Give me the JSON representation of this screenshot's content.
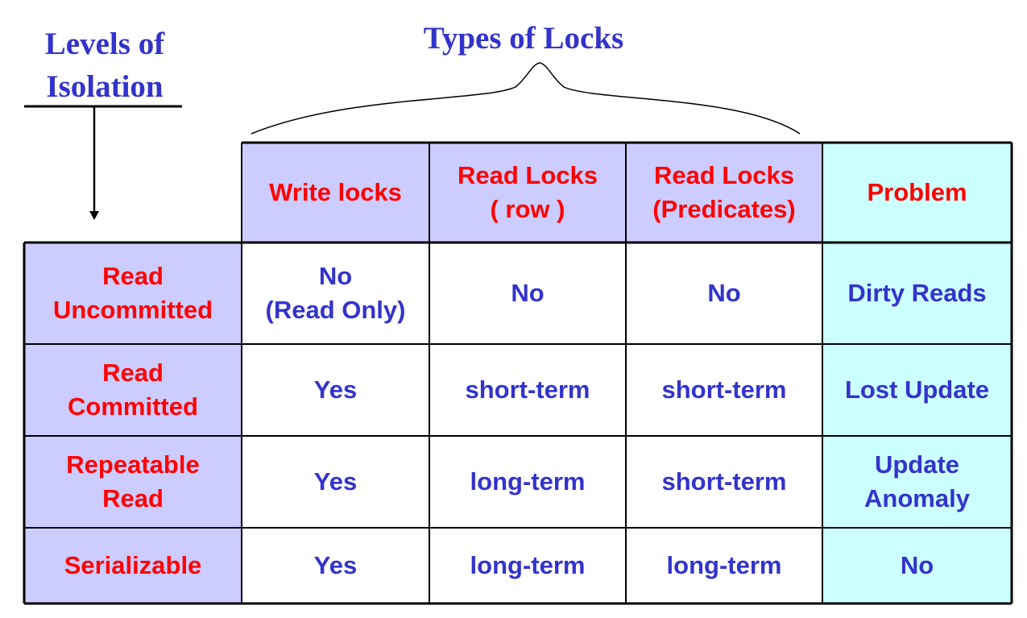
{
  "titles": {
    "levels_line1": "Levels of",
    "levels_line2": "Isolation",
    "types": "Types of Locks"
  },
  "columns": [
    "Write locks",
    "Read Locks\n( row )",
    "Read Locks\n(Predicates)",
    "Problem"
  ],
  "rows": [
    {
      "level": "Read\nUncommitted",
      "write": "No\n(Read Only)",
      "read_row": "No",
      "read_pred": "No",
      "problem": "Dirty Reads"
    },
    {
      "level": "Read\nCommitted",
      "write": "Yes",
      "read_row": "short-term",
      "read_pred": "short-term",
      "problem": "Lost Update"
    },
    {
      "level": "Repeatable\nRead",
      "write": "Yes",
      "read_row": "long-term",
      "read_pred": "short-term",
      "problem": "Update\nAnomaly"
    },
    {
      "level": "Serializable",
      "write": "Yes",
      "read_row": "long-term",
      "read_pred": "long-term",
      "problem": "No"
    }
  ],
  "colors": {
    "title_blue": "#3333CC",
    "header_red": "#FF0000",
    "lavender": "#CCCCFF",
    "light_cyan": "#CCFFFF"
  }
}
